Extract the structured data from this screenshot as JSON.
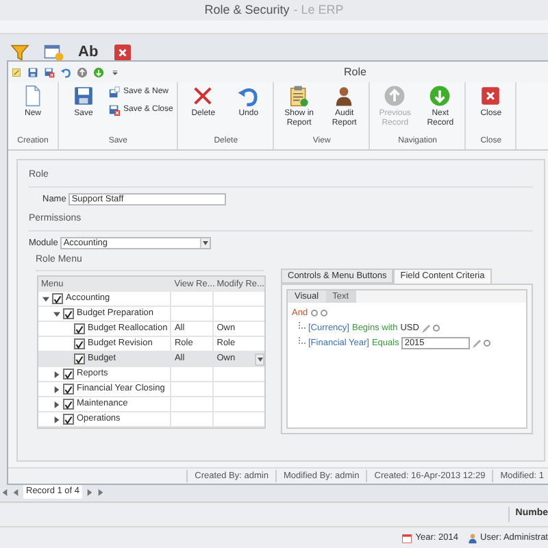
{
  "app_window": {
    "title": "Role & Security",
    "subtitle": "- Le ERP"
  },
  "app_toolbar": [
    {
      "kind": "icon"
    },
    {
      "kind": "icon"
    },
    {
      "kind": "text",
      "label": "Ab"
    },
    {
      "kind": "icon"
    }
  ],
  "role_window": {
    "title": "Role"
  },
  "ribbon_groups": [
    {
      "label": "Creation",
      "buttons": [
        {
          "label": "New",
          "kind": "large",
          "disabled": false
        }
      ]
    },
    {
      "label": "Save",
      "buttons": [
        {
          "label": "Save",
          "kind": "large",
          "disabled": false
        },
        {
          "label": "Save & New",
          "kind": "small",
          "disabled": false
        },
        {
          "label": "Save & Close",
          "kind": "small",
          "disabled": false
        }
      ]
    },
    {
      "label": "Delete",
      "buttons": [
        {
          "label": "Delete",
          "kind": "large",
          "disabled": false
        },
        {
          "label": "Undo",
          "kind": "large",
          "disabled": false
        }
      ]
    },
    {
      "label": "View",
      "buttons": [
        {
          "label": "Show in Report",
          "kind": "large",
          "disabled": false
        },
        {
          "label": "Audit Report",
          "kind": "large",
          "disabled": false
        }
      ]
    },
    {
      "label": "Navigation",
      "buttons": [
        {
          "label": "Previous Record",
          "kind": "large",
          "disabled": true
        },
        {
          "label": "Next Record",
          "kind": "large",
          "disabled": false
        }
      ]
    },
    {
      "label": "Close",
      "buttons": [
        {
          "label": "Close",
          "kind": "large",
          "disabled": false
        }
      ]
    }
  ],
  "role_section": {
    "title": "Role",
    "name_label": "Name",
    "name_value": "Support Staff"
  },
  "permissions_section": {
    "title": "Permissions",
    "module_label": "Module",
    "module_value": "Accounting"
  },
  "role_menu": {
    "title": "Role Menu",
    "columns": [
      "Menu",
      "View Re...",
      "Modify Re..."
    ],
    "rows": [
      {
        "label": "Accounting",
        "checked": true,
        "expanded": true,
        "selected": false,
        "children": [
          {
            "label": "Budget Preparation",
            "checked": true,
            "expanded": true,
            "selected": false,
            "children": [
              {
                "label": "Budget Reallocation",
                "checked": true,
                "selected": false,
                "view": "All",
                "modify": "Own"
              },
              {
                "label": "Budget Revision",
                "checked": true,
                "selected": false,
                "view": "Role",
                "modify": "Role"
              },
              {
                "label": "Budget",
                "checked": true,
                "selected": true,
                "view": "All",
                "modify": "Own"
              }
            ]
          },
          {
            "label": "Reports",
            "checked": true,
            "expanded": false,
            "selected": false
          },
          {
            "label": "Financial Year Closing",
            "checked": true,
            "expanded": false,
            "selected": false
          },
          {
            "label": "Maintenance",
            "checked": true,
            "expanded": false,
            "selected": false
          },
          {
            "label": "Operations",
            "checked": true,
            "expanded": false,
            "selected": false
          }
        ]
      }
    ]
  },
  "criteria_tabs": [
    {
      "label": "Controls & Menu Buttons",
      "selected": false
    },
    {
      "label": "Field Content Criteria",
      "selected": true
    }
  ],
  "editor_tabs": [
    {
      "label": "Visual",
      "selected": true
    },
    {
      "label": "Text",
      "selected": false
    }
  ],
  "filter": {
    "operator": "And",
    "conditions": [
      {
        "field": "[Currency]",
        "operator": "Begins with",
        "value": "USD",
        "editing": false
      },
      {
        "field": "[Financial Year]",
        "operator": "Equals",
        "value": "2015",
        "editing": true
      }
    ]
  },
  "status_bar": [
    "Created By: admin",
    "Modified By: admin",
    "Created: 16-Apr-2013 12:29",
    "Modified: 1"
  ],
  "record_navigator": {
    "text": "Record 1 of 4"
  },
  "bottom_panel": {
    "label": "Numbe"
  },
  "app_status": [
    "Year: 2014",
    "User: Administrat"
  ]
}
